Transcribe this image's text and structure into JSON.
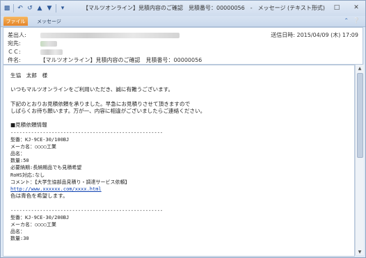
{
  "window": {
    "title": "【マルツオンライン】見積内容のご確認　見積番号：00000056　-　メッセージ (テキスト形式)",
    "controls": [
      "minimize-icon",
      "maximize-icon",
      "close-icon"
    ]
  },
  "quick_access": [
    "save-icon",
    "undo-icon",
    "redo-icon",
    "up-icon",
    "down-icon",
    "customize-icon"
  ],
  "ribbon": {
    "file_tab": "ファイル",
    "message_tab": "メッセージ",
    "help_icon": "help-icon"
  },
  "header": {
    "from_label": "差出人:",
    "to_label": "宛先:",
    "cc_label": "ＣＣ:",
    "subject_label": "件名:",
    "subject": "【マルツオンライン】見積内容のご確認　見積番号：00000056",
    "sent_label": "送信日時:",
    "sent_value": "2015/04/09 (木) 17:09"
  },
  "body": {
    "lines": [
      "生協　太郎　様",
      "",
      "いつもマルツオンラインをご利用いただき、誠に有難うございます。",
      "",
      "下記のとおりお見積依頼を承りました。早急にお見積りさせて頂きますので",
      "しばらくお待ち願います。万が一、内容に相違がございましたらご連絡ください。",
      "",
      "■見積依頼情報",
      "----------------------------------------------------",
      "型番：KJ-9CE-30/100BJ",
      "メーカ名：○○○○工業",
      "品名：",
      "数量:50",
      "必要納期:長納期品でも見積希望",
      "RoHS対応:なし",
      "コメント：【大学生協部品見積り・調達サービス依頼】",
      "http://www.xxxxxx.com/xxxx.html",
      "色は青色を希望します。",
      "",
      "----------------------------------------------------",
      "型番：KJ-9CE-30/200BJ",
      "メーカ名：○○○○工業",
      "品名：",
      "数量:30"
    ],
    "link_index": 16
  }
}
